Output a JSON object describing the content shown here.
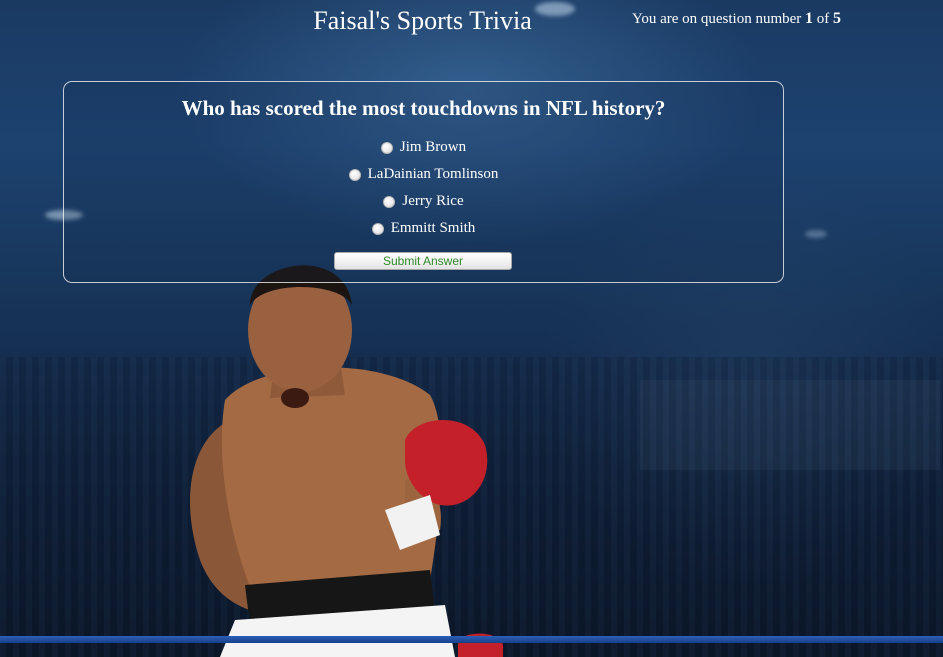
{
  "header": {
    "title": "Faisal's Sports Trivia",
    "progress_prefix": "You are on question number",
    "current_question": "1",
    "of_word": "of",
    "total_questions": "5"
  },
  "quiz": {
    "question": "Who has scored the most touchdowns in NFL history?",
    "options": [
      {
        "label": "Jim Brown"
      },
      {
        "label": "LaDainian Tomlinson"
      },
      {
        "label": "Jerry Rice"
      },
      {
        "label": "Emmitt Smith"
      }
    ],
    "submit_label": "Submit Answer"
  },
  "background": {
    "description_icon": "boxer-photo"
  }
}
